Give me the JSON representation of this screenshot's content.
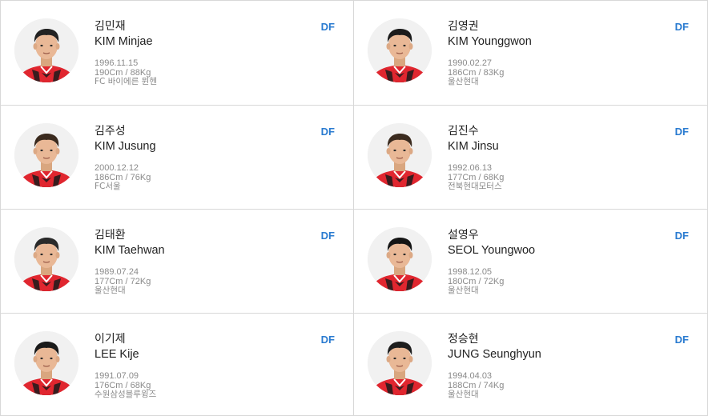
{
  "players": [
    {
      "korean_name": "김민재",
      "english_name": "KIM Minjae",
      "birth": "1996.11.15",
      "body": "190Cm / 88Kg",
      "club": "FC 바이에른 뮌헨",
      "position": "DF",
      "hair": "#222"
    },
    {
      "korean_name": "김영권",
      "english_name": "KIM Younggwon",
      "birth": "1990.02.27",
      "body": "186Cm / 83Kg",
      "club": "울산현대",
      "position": "DF",
      "hair": "#1c1c1c"
    },
    {
      "korean_name": "김주성",
      "english_name": "KIM Jusung",
      "birth": "2000.12.12",
      "body": "186Cm / 76Kg",
      "club": "FC서울",
      "position": "DF",
      "hair": "#3a2a1e"
    },
    {
      "korean_name": "김진수",
      "english_name": "KIM Jinsu",
      "birth": "1992.06.13",
      "body": "177Cm / 68Kg",
      "club": "전북현대모터스",
      "position": "DF",
      "hair": "#3b2b1f"
    },
    {
      "korean_name": "김태환",
      "english_name": "KIM Taehwan",
      "birth": "1989.07.24",
      "body": "177Cm / 72Kg",
      "club": "울산현대",
      "position": "DF",
      "hair": "#2a2a2a"
    },
    {
      "korean_name": "설영우",
      "english_name": "SEOL Youngwoo",
      "birth": "1998.12.05",
      "body": "180Cm / 72Kg",
      "club": "울산현대",
      "position": "DF",
      "hair": "#151515"
    },
    {
      "korean_name": "이기제",
      "english_name": "LEE Kije",
      "birth": "1991.07.09",
      "body": "176Cm / 68Kg",
      "club": "수원삼성블루윙즈",
      "position": "DF",
      "hair": "#1a1a1a"
    },
    {
      "korean_name": "정승현",
      "english_name": "JUNG Seunghyun",
      "birth": "1994.04.03",
      "body": "188Cm / 74Kg",
      "club": "울산현대",
      "position": "DF",
      "hair": "#1e1e1e"
    }
  ],
  "colors": {
    "position": "#2a7bd0",
    "jersey": "#e0262f",
    "jersey_dark": "#1b1b1b",
    "skin": "#e9b896"
  },
  "icons": {
    "photo": "player-photo-icon"
  }
}
